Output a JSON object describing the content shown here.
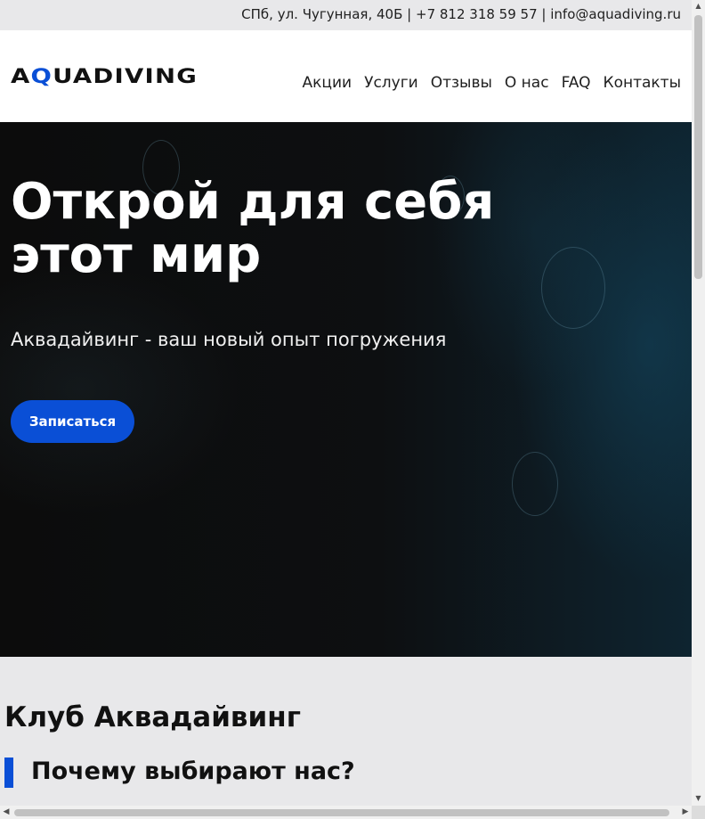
{
  "topbar": {
    "address": "СПб, ул. Чугунная, 40Б",
    "separator1": "|",
    "phone": "+7 812 318 59 57",
    "separator2": "|",
    "email": "info@aquadiving.ru"
  },
  "header": {
    "logo_text_a": "A",
    "logo_text_q": "Q",
    "logo_text_rest": "UADIVING",
    "nav": [
      {
        "label": "Акции"
      },
      {
        "label": "Услуги"
      },
      {
        "label": "Отзывы"
      },
      {
        "label": "О нас"
      },
      {
        "label": "FAQ"
      },
      {
        "label": "Контакты"
      }
    ]
  },
  "hero": {
    "title_line1": "Открой для себя",
    "title_line2": "этот мир",
    "subtitle": "Аквадайвинг - ваш новый опыт погружения",
    "cta_label": "Записаться"
  },
  "content": {
    "club_title": "Клуб Аквадайвинг",
    "why_title": "Почему выбирают нас?"
  },
  "colors": {
    "accent": "#0a4fd6",
    "hero_bg": "#0d0f11",
    "page_bg": "#e8e8ea"
  }
}
